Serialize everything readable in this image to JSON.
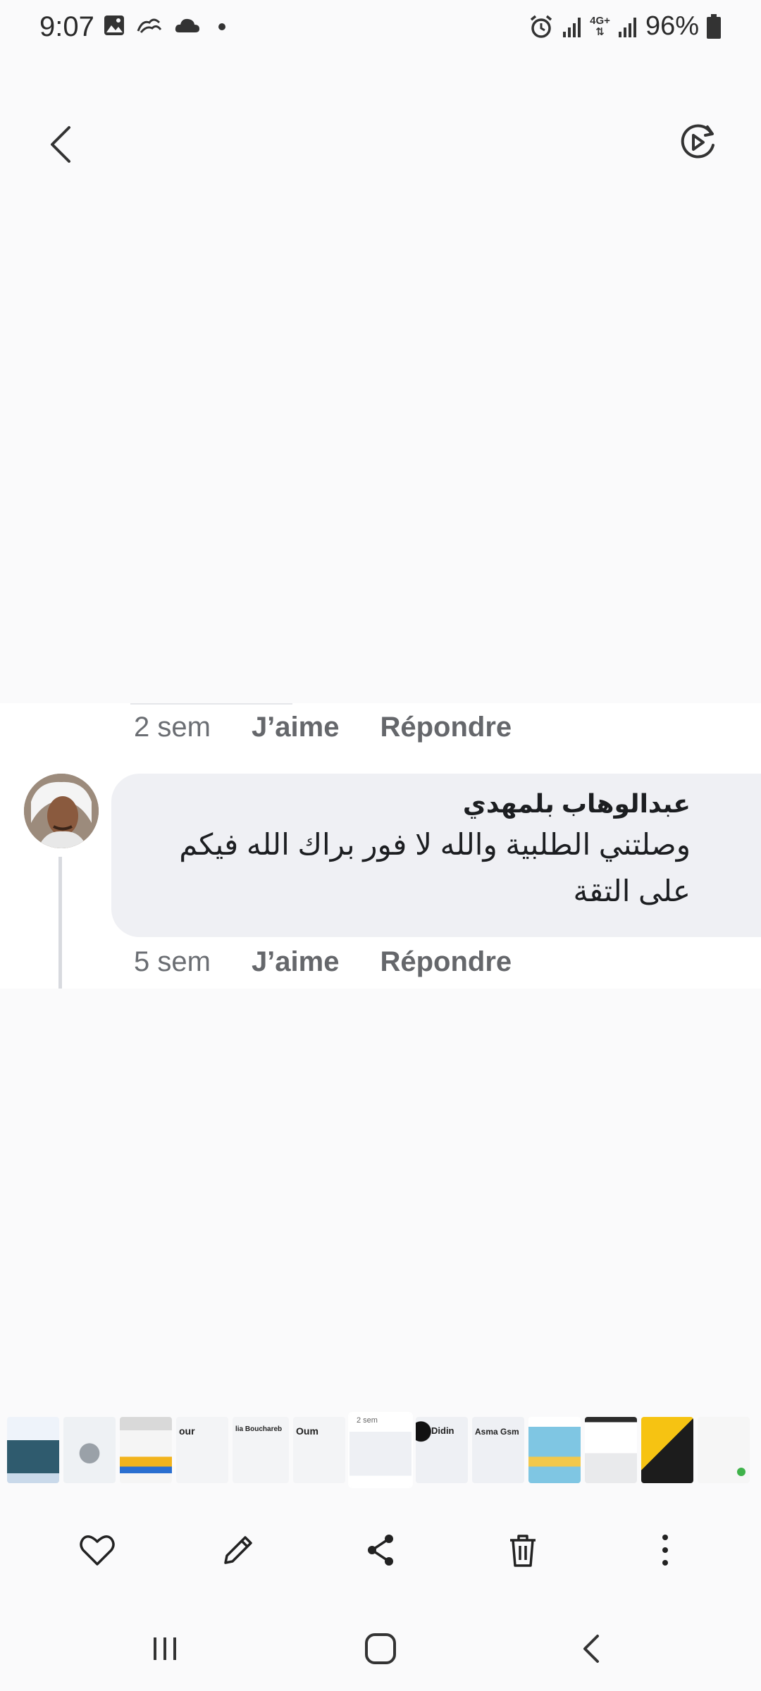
{
  "status_bar": {
    "time": "9:07",
    "network": "4G+",
    "battery": "96%",
    "left_icons": [
      "gallery-icon",
      "cloud-link-icon",
      "cloud-icon",
      "dot-icon"
    ],
    "right_icons": [
      "alarm-icon",
      "signal-icon",
      "network-icon",
      "signal-icon-2",
      "battery-icon"
    ]
  },
  "top_bar": {
    "back_icon": "chevron-left-icon",
    "motion_icon": "motion-photo-icon"
  },
  "comment_section": {
    "previous_comment": {
      "time": "2 sem",
      "like_label": "J’aime",
      "reply_label": "Répondre"
    },
    "comment": {
      "author": "عبدالوهاب بلمهدي",
      "text": "وصلتني الطلبية والله لا فور براك الله فيكم على التقة",
      "time": "5 sem",
      "like_label": "J’aime",
      "reply_label": "Répondre"
    }
  },
  "filmstrip": {
    "thumbnails": [
      {
        "label": ""
      },
      {
        "label": ""
      },
      {
        "label": ""
      },
      {
        "label": "our"
      },
      {
        "label": "lia Bouchareb"
      },
      {
        "label": "Oum"
      },
      {
        "label": "2 sem"
      },
      {
        "label": "Didin"
      },
      {
        "label": "Asma Gsm"
      },
      {
        "label": ""
      },
      {
        "label": ""
      },
      {
        "label": ""
      },
      {
        "label": ""
      }
    ]
  },
  "bottom_actions": [
    "heart-icon",
    "edit-icon",
    "share-icon",
    "trash-icon",
    "more-icon"
  ],
  "nav_bar": [
    "recents-icon",
    "home-icon",
    "back-nav-icon"
  ],
  "colors": {
    "background": "#fafafb",
    "bubble": "#eff0f4",
    "meta_text": "#65676b"
  }
}
